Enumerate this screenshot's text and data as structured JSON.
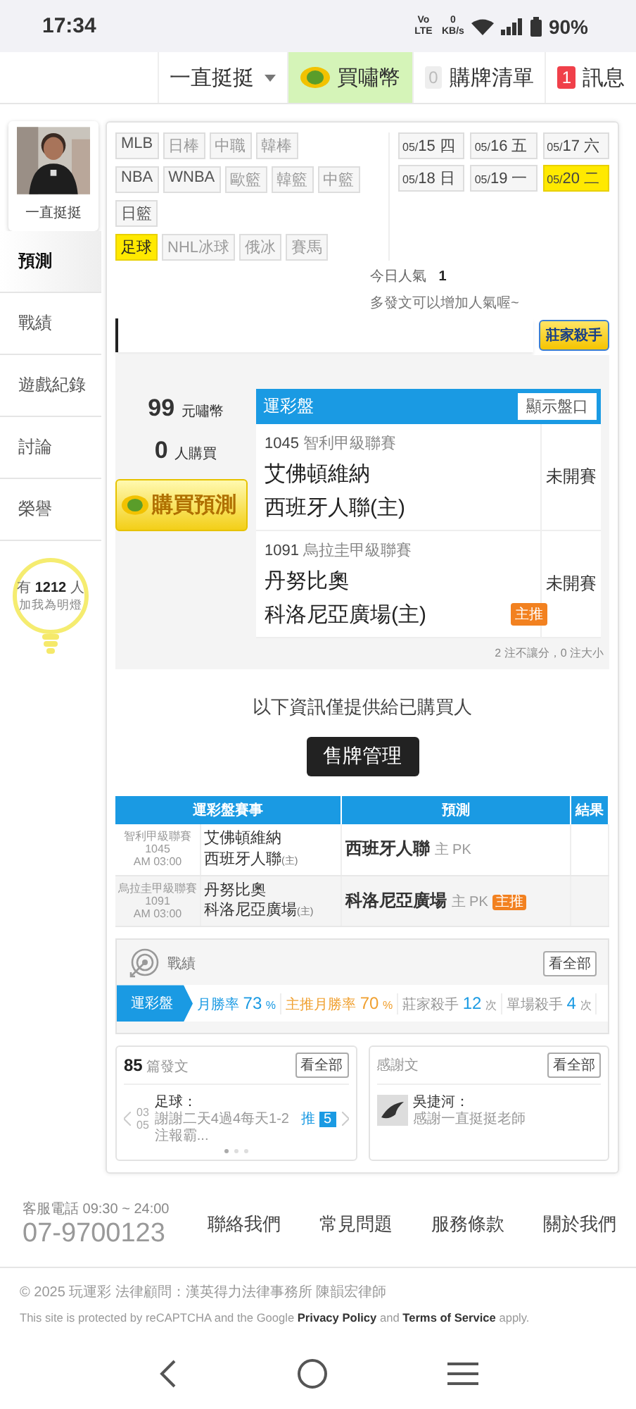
{
  "status_bar": {
    "time": "17:34",
    "network": "Vo LTE",
    "data_rate": "0 KB/s",
    "battery": "90%"
  },
  "nav": [
    {
      "label": "一直挺挺",
      "kind": "dropdown"
    },
    {
      "label": "買嘯幣",
      "kind": "coin"
    },
    {
      "label": "購牌清單",
      "kind": "count",
      "count": "0"
    },
    {
      "label": "訊息",
      "kind": "alert",
      "count": "1"
    }
  ],
  "sidebar": {
    "name": "一直挺挺",
    "items": [
      {
        "label": "預測",
        "selected": true
      },
      {
        "label": "戰績",
        "selected": false
      },
      {
        "label": "遊戲紀錄",
        "selected": false
      },
      {
        "label": "討論",
        "selected": false
      },
      {
        "label": "榮譽",
        "selected": false
      }
    ],
    "fans": {
      "prefix": "有",
      "count": "1212",
      "suffix": "人",
      "note": "加我為明燈"
    }
  },
  "sport_rows": [
    {
      "tags": [
        {
          "label": "MLB",
          "enabled": true,
          "selected": false
        },
        {
          "label": "日棒",
          "enabled": false,
          "selected": false
        },
        {
          "label": "中職",
          "enabled": false,
          "selected": false
        },
        {
          "label": "韓棒",
          "enabled": false,
          "selected": false
        }
      ]
    },
    {
      "tags": [
        {
          "label": "NBA",
          "enabled": true,
          "selected": false
        },
        {
          "label": "WNBA",
          "enabled": true,
          "selected": false
        },
        {
          "label": "歐籃",
          "enabled": false,
          "selected": false
        },
        {
          "label": "韓籃",
          "enabled": false,
          "selected": false
        },
        {
          "label": "中籃",
          "enabled": false,
          "selected": false
        }
      ]
    },
    {
      "tags": [
        {
          "label": "日籃",
          "enabled": true,
          "selected": false
        }
      ]
    },
    {
      "tags": [
        {
          "label": "足球",
          "enabled": true,
          "selected": true
        },
        {
          "label": "NHL冰球",
          "enabled": false,
          "selected": false
        },
        {
          "label": "俄冰",
          "enabled": false,
          "selected": false
        },
        {
          "label": "賽馬",
          "enabled": false,
          "selected": false
        }
      ]
    }
  ],
  "dates": [
    {
      "date": "05/15",
      "weekday": "四",
      "selected": false
    },
    {
      "date": "05/16",
      "weekday": "五",
      "selected": false
    },
    {
      "date": "05/17",
      "weekday": "六",
      "selected": false
    },
    {
      "date": "05/18",
      "weekday": "日",
      "selected": false
    },
    {
      "date": "05/19",
      "weekday": "一",
      "selected": false
    },
    {
      "date": "05/20",
      "weekday": "二",
      "selected": true
    }
  ],
  "popularity": {
    "label": "今日人氣",
    "value": "1",
    "hint": "多發文可以增加人氣喔~",
    "badge": "莊家殺手"
  },
  "prediction": {
    "price": "99",
    "price_unit": "元嘯幣",
    "buyers": "0",
    "buyers_unit": "人購買",
    "buy_button": "購買預測",
    "board": {
      "title": "運彩盤",
      "toggle": "顯示盤口",
      "games": [
        {
          "code": "1045",
          "league": "智利甲級聯賽",
          "away": "艾佛頓維納",
          "home": "西班牙人聯(主)",
          "status": "未開賽"
        },
        {
          "code": "1091",
          "league": "烏拉圭甲級聯賽",
          "away": "丹努比奧",
          "home": "科洛尼亞廣場(主)",
          "status": "未開賽",
          "tag": "主推"
        }
      ],
      "note": "2 注不讓分，0 注大小"
    }
  },
  "notice": "以下資訊僅提供給已購買人",
  "manage_button": "售牌管理",
  "history": {
    "columns": [
      "運彩盤賽事",
      "預測",
      "結果"
    ],
    "rows": [
      {
        "league": "智利甲級聯賽",
        "code": "1045",
        "time": "AM 03:00",
        "away": "艾佛頓維納",
        "home": "西班牙人聯",
        "home_mark": "(主)",
        "pick": "西班牙人聯",
        "pick_side": "主",
        "pick_type": "PK"
      },
      {
        "league": "烏拉圭甲級聯賽",
        "code": "1091",
        "time": "AM 03:00",
        "away": "丹努比奧",
        "home": "科洛尼亞廣場",
        "home_mark": "(主)",
        "pick": "科洛尼亞廣場",
        "pick_side": "主",
        "pick_type": "PK",
        "tag": "主推"
      }
    ]
  },
  "stats": {
    "title": "戰績",
    "more": "看全部",
    "tab": "運彩盤",
    "items": [
      {
        "label": "月勝率",
        "value": "73",
        "unit": "%",
        "kind": "primary"
      },
      {
        "label": "主推月勝率",
        "value": "70",
        "unit": "%",
        "kind": "featured"
      },
      {
        "label": "莊家殺手",
        "value": "12",
        "unit": "次",
        "kind": "plain"
      },
      {
        "label": "單場殺手",
        "value": "4",
        "unit": "次",
        "kind": "plain"
      }
    ]
  },
  "posts": {
    "count": "85",
    "label": "篇發文",
    "more": "看全部",
    "item": {
      "day": "03",
      "month": "05",
      "sport": "足球：",
      "text": "謝謝二天4過4每天1-2注報霸...",
      "push_label": "推",
      "push_count": "5"
    }
  },
  "thanks": {
    "title": "感謝文",
    "more": "看全部",
    "item": {
      "author": "吳捷河：",
      "text": "感謝一直挺挺老師"
    }
  },
  "footer": {
    "phone_label": "客服電話 09:30 ~ 24:00",
    "phone": "07-9700123",
    "links": [
      "聯絡我們",
      "常見問題",
      "服務條款",
      "關於我們"
    ],
    "copyright": "© 2025 玩運彩 法律顧問：漢英得力法律事務所 陳韻宏律師",
    "recaptcha": {
      "before": "This site is protected by reCAPTCHA and the Google",
      "link1": "Privacy Policy",
      "middle": "and",
      "link2": "Terms of Service",
      "after": "apply."
    }
  }
}
